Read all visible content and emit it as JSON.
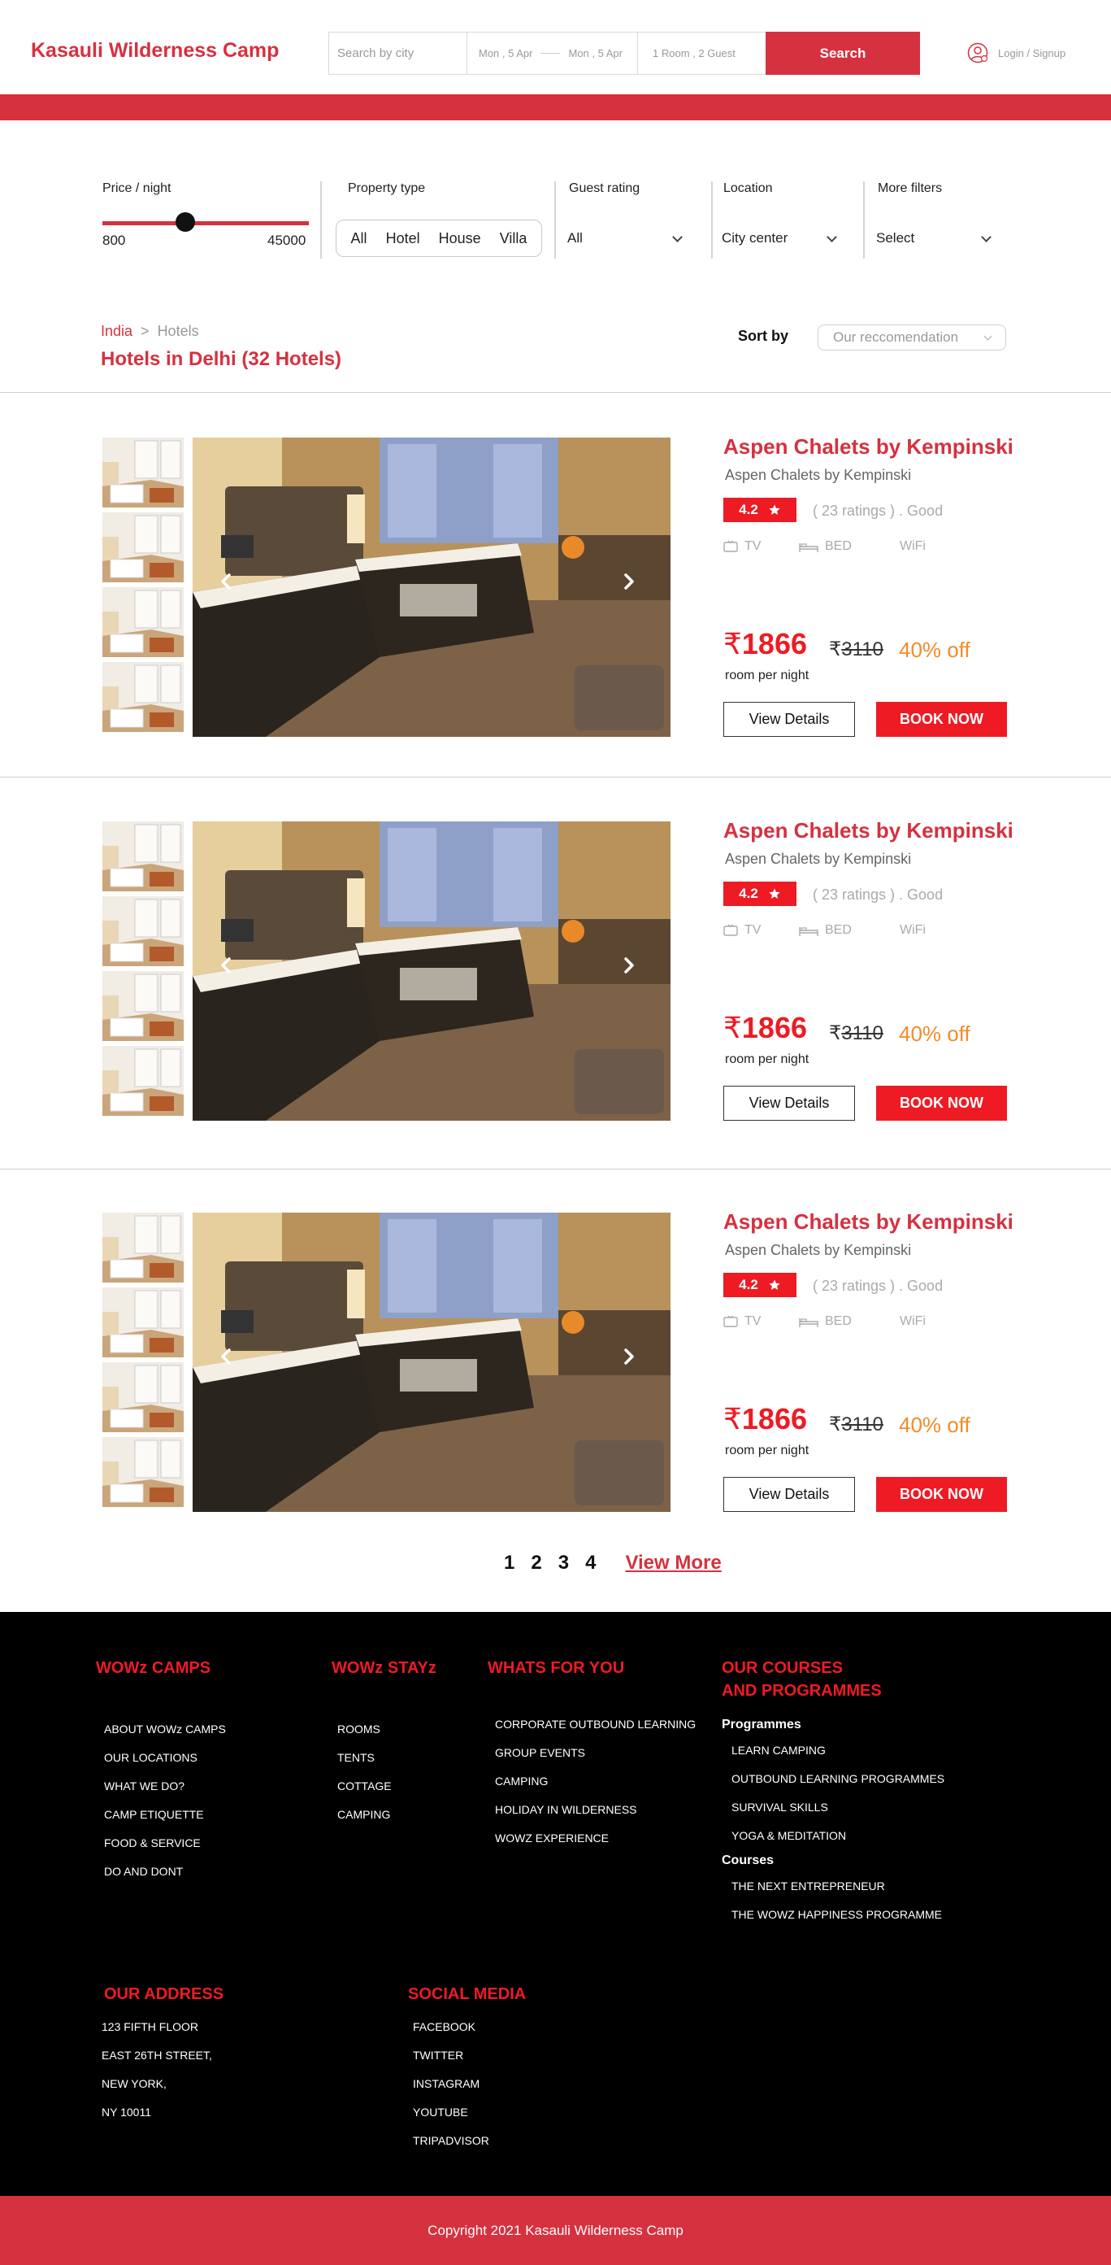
{
  "header": {
    "brand": "Kasauli Wilderness Camp",
    "search": {
      "city_placeholder": "Search by city",
      "checkin": "Mon , 5 Apr",
      "checkout": "Mon , 5 Apr",
      "guests": "1 Room , 2 Guest",
      "button": "Search"
    },
    "login": "Login / Signup"
  },
  "filters": {
    "price": {
      "title": "Price / night",
      "min": "800",
      "max": "45000",
      "level": 0.4
    },
    "property_type": {
      "title": "Property type",
      "options": [
        "All",
        "Hotel",
        "House",
        "Villa"
      ]
    },
    "guest_rating": {
      "title": "Guest rating",
      "value": "All"
    },
    "location": {
      "title": "Location",
      "value": "City center"
    },
    "more": {
      "title": "More filters",
      "value": "Select"
    }
  },
  "breadcrumb": {
    "items": [
      "India",
      "Hotels"
    ],
    "separator": ">"
  },
  "heading": "Hotels in Delhi (32 Hotels)",
  "sort": {
    "label": "Sort by",
    "value": "Our reccomendation"
  },
  "hotels": [
    {
      "name": "Aspen Chalets by Kempinski",
      "subtitle": "Aspen Chalets by Kempinski",
      "rating": "4.2",
      "ratings_text": "( 23 ratings ) . Good",
      "amenities": [
        "TV",
        "BED",
        "WiFi"
      ],
      "price": "1866",
      "currency": "₹",
      "old_price": "3110",
      "discount": "40% off",
      "per_night": "room per night",
      "view_label": "View Details",
      "book_label": "BOOK NOW"
    },
    {
      "name": "Aspen Chalets by Kempinski",
      "subtitle": "Aspen Chalets by Kempinski",
      "rating": "4.2",
      "ratings_text": "( 23 ratings ) . Good",
      "amenities": [
        "TV",
        "BED",
        "WiFi"
      ],
      "price": "1866",
      "currency": "₹",
      "old_price": "3110",
      "discount": "40% off",
      "per_night": "room per night",
      "view_label": "View Details",
      "book_label": "BOOK NOW"
    },
    {
      "name": "Aspen Chalets by Kempinski",
      "subtitle": "Aspen Chalets by Kempinski",
      "rating": "4.2",
      "ratings_text": "( 23 ratings ) . Good",
      "amenities": [
        "TV",
        "BED",
        "WiFi"
      ],
      "price": "1866",
      "currency": "₹",
      "old_price": "3110",
      "discount": "40% off",
      "per_night": "room per night",
      "view_label": "View Details",
      "book_label": "BOOK NOW"
    }
  ],
  "pagination": {
    "pages": [
      "1",
      "2",
      "3",
      "4"
    ],
    "more": "View More"
  },
  "footer": {
    "camps": {
      "title": "WOWz CAMPS",
      "items": [
        "ABOUT  WOWz CAMPS",
        "OUR LOCATIONS",
        "WHAT WE DO?",
        "CAMP ETIQUETTE",
        "FOOD & SERVICE",
        "DO AND DONT"
      ]
    },
    "stays": {
      "title": "WOWz STAYz",
      "items": [
        "ROOMS",
        "TENTS",
        "COTTAGE",
        "CAMPING"
      ]
    },
    "foryou": {
      "title": "WHATS FOR YOU",
      "items": [
        "CORPORATE OUTBOUND LEARNING",
        "GROUP EVENTS",
        "CAMPING",
        "HOLIDAY IN WILDERNESS",
        "WOWZ EXPERIENCE"
      ]
    },
    "courses": {
      "title_line1": "OUR COURSES",
      "title_line2": "AND PROGRAMMES",
      "programmes_label": "Programmes",
      "programmes": [
        "LEARN CAMPING",
        "OUTBOUND LEARNING PROGRAMMES",
        "SURVIVAL SKILLS",
        "YOGA & MEDITATION"
      ],
      "courses_label": "Courses",
      "courses": [
        "THE NEXT ENTREPRENEUR",
        "THE WOWZ HAPPINESS PROGRAMME"
      ]
    },
    "address": {
      "title": "OUR ADDRESS",
      "lines": [
        "123 FIFTH FLOOR",
        "EAST 26TH STREET,",
        "NEW YORK,",
        "NY 10011"
      ]
    },
    "social": {
      "title": "SOCIAL MEDIA",
      "items": [
        "FACEBOOK",
        "TWITTER",
        "INSTAGRAM",
        "YOUTUBE",
        "TRIPADVISOR"
      ]
    },
    "copyright": "Copyright 2021 Kasauli Wilderness Camp"
  },
  "colors": {
    "brand_red": "#d6313f",
    "accent_red": "#ee1b24",
    "discount_orange": "#f28c28"
  }
}
